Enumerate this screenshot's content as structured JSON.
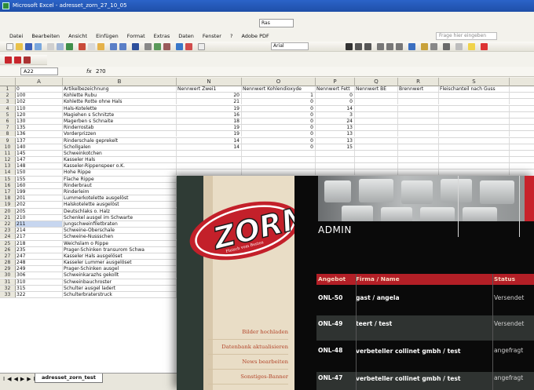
{
  "excel": {
    "title": "Microsoft Excel - adresset_zorn_27_10_05",
    "font_combo": "Ras",
    "menu": [
      "Datei",
      "Bearbeiten",
      "Ansicht",
      "Einfügen",
      "Format",
      "Extras",
      "Daten",
      "Fenster",
      "?",
      "Adobe PDF"
    ],
    "help_placeholder": "Frage hier eingeben",
    "font_name": "Arial",
    "name_box": "A22",
    "formula": "fx",
    "formula_value": "2?0",
    "columns": [
      "A",
      "B",
      "N",
      "O",
      "P",
      "Q",
      "R",
      "S"
    ],
    "column_widths": [
      60,
      145,
      83,
      94,
      50,
      55,
      52,
      90
    ],
    "rows": [
      [
        "1",
        "0",
        "Artikelbezeichnung",
        "Nennwert Zwei1",
        "Nennwert Kohlendioxyde",
        "Nennwert Fett",
        "Nennwert BE",
        "Brennwert",
        "Fleischanteil nach Guss"
      ],
      [
        "2",
        "100",
        "Kohlette Rubu",
        "20",
        "1",
        "0",
        "",
        "",
        ""
      ],
      [
        "3",
        "102",
        "Kohlette Rotte ohne Hals",
        "21",
        "0",
        "0",
        "",
        "",
        ""
      ],
      [
        "4",
        "110",
        "Hals-Kotelette",
        "19",
        "0",
        "14",
        "",
        "",
        ""
      ],
      [
        "5",
        "120",
        "Magiehen s Schnitzte",
        "16",
        "0",
        "3",
        "",
        "",
        ""
      ],
      [
        "6",
        "130",
        "Magerben s Schnaite",
        "18",
        "0",
        "24",
        "",
        "",
        ""
      ],
      [
        "7",
        "135",
        "Rinderrostab",
        "19",
        "0",
        "13",
        "",
        "",
        ""
      ],
      [
        "8",
        "136",
        "Vorderprizzen",
        "19",
        "0",
        "13",
        "",
        "",
        ""
      ],
      [
        "9",
        "137",
        "Rinderschale geprekelt",
        "14",
        "0",
        "13",
        "",
        "",
        ""
      ],
      [
        "10",
        "140",
        "Schollgalen",
        "14",
        "0",
        "15",
        "",
        "",
        ""
      ],
      [
        "11",
        "145",
        "Schweinkotchen",
        "",
        "",
        "",
        "",
        "",
        ""
      ],
      [
        "12",
        "147",
        "Kasseler Hals",
        "",
        "",
        "",
        "",
        "",
        ""
      ],
      [
        "13",
        "148",
        "Kasseler-Rippenspeer o.K.",
        "",
        "",
        "",
        "",
        "",
        ""
      ],
      [
        "14",
        "150",
        "Hohe Rippe",
        "",
        "",
        "",
        "",
        "",
        ""
      ],
      [
        "15",
        "155",
        "Flache Rippe",
        "",
        "",
        "",
        "",
        "",
        ""
      ],
      [
        "16",
        "160",
        "Rinderbraut",
        "",
        "",
        "",
        "",
        "",
        ""
      ],
      [
        "17",
        "199",
        "Rinderleim",
        "",
        "",
        "",
        "",
        "",
        ""
      ],
      [
        "18",
        "201",
        "Lummerkotelette ausgelöst",
        "",
        "",
        "",
        "",
        "",
        ""
      ],
      [
        "19",
        "202",
        "Halskotelette ausgelöst",
        "",
        "",
        "",
        "",
        "",
        ""
      ],
      [
        "20",
        "205",
        "Deutschlaks o. Halz",
        "",
        "",
        "",
        "",
        "",
        ""
      ],
      [
        "21",
        "210",
        "Schenkel ausgel im Schwarte",
        "",
        "",
        "",
        "",
        "",
        ""
      ],
      [
        "22",
        "211",
        "Jungschweinfiletbraten",
        "",
        "",
        "",
        "",
        "",
        ""
      ],
      [
        "23",
        "214",
        "Schweine-Oberschale",
        "",
        "",
        "",
        "",
        "",
        ""
      ],
      [
        "24",
        "217",
        "Schweine-Nussschen",
        "",
        "",
        "",
        "",
        "",
        ""
      ],
      [
        "25",
        "218",
        "Weichslam o Rippe",
        "",
        "",
        "",
        "",
        "",
        ""
      ],
      [
        "26",
        "235",
        "Prager-Schinken transurom Schwa",
        "",
        "",
        "",
        "",
        "",
        ""
      ],
      [
        "27",
        "247",
        "Kasseler Hals ausgelöset",
        "",
        "",
        "",
        "",
        "",
        ""
      ],
      [
        "28",
        "248",
        "Kasseler Lummer ausgelöset",
        "",
        "",
        "",
        "",
        "",
        ""
      ],
      [
        "29",
        "249",
        "Prager-Schinken ausgel",
        "",
        "",
        "",
        "",
        "",
        ""
      ],
      [
        "30",
        "306",
        "Schweinkarazhs gekollt",
        "",
        "",
        "",
        "",
        "",
        ""
      ],
      [
        "31",
        "310",
        "Schweinbauchroster",
        "",
        "",
        "",
        "",
        "",
        ""
      ],
      [
        "32",
        "315",
        "Schulter ausgel ladert",
        "",
        "",
        "",
        "",
        "",
        ""
      ],
      [
        "33",
        "322",
        "Schulterbraterstruck",
        "",
        "",
        "",
        "",
        "",
        ""
      ]
    ],
    "tab_nav": "I◀◀▶▶I",
    "sheet_tab": "adresset_zorn_test"
  },
  "zorn": {
    "logo_text": "ZORN",
    "logo_tagline": "Fleisch vom Besten",
    "nav": [
      "Bilder hochladen",
      "Datenbank aktualisieren",
      "News bearbeiten",
      "Sonstiges-Banner"
    ],
    "admin_title": "ADMIN",
    "table_headers": [
      "Angebot",
      "Firma / Name",
      "Status"
    ],
    "table_rows": [
      {
        "angebot": "ONL-50",
        "name": "gast / angela",
        "status": "Versendet"
      },
      {
        "angebot": "ONL-49",
        "name": "teert / test",
        "status": "Versendet"
      },
      {
        "angebot": "ONL-48",
        "name": "verbeteller collinet gmbh / test",
        "status": "angefragt"
      },
      {
        "angebot": "ONL-47",
        "name": "verbeteller collinet gmbh / test",
        "status": "angefragt"
      }
    ]
  },
  "colors": {
    "excel_title_blue": "#2b63c8",
    "zorn_red": "#b31f26",
    "zorn_nav_text": "#b2452a",
    "zorn_panel": "#e9ddc6"
  }
}
